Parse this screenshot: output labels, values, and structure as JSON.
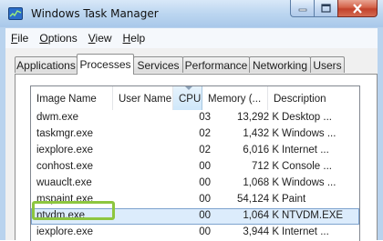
{
  "window": {
    "title": "Windows Task Manager"
  },
  "menu": {
    "file": {
      "mnemonic": "F",
      "rest": "ile"
    },
    "options": {
      "mnemonic": "O",
      "rest": "ptions"
    },
    "view": {
      "mnemonic": "V",
      "rest": "iew"
    },
    "help": {
      "mnemonic": "H",
      "rest": "elp"
    }
  },
  "tabs": {
    "applications": "Applications",
    "processes": "Processes",
    "services": "Services",
    "performance": "Performance",
    "networking": "Networking",
    "users": "Users",
    "active": "Processes"
  },
  "table": {
    "headers": {
      "image_name": "Image Name",
      "user_name": "User Name",
      "cpu": "CPU",
      "memory": "Memory (...",
      "description": "Description"
    },
    "sorted_column": "CPU",
    "rows": [
      {
        "name": "dwm.exe",
        "user": "",
        "cpu": "03",
        "mem": "13,292 K",
        "desc": "Desktop ..."
      },
      {
        "name": "taskmgr.exe",
        "user": "",
        "cpu": "02",
        "mem": "1,432 K",
        "desc": "Windows ..."
      },
      {
        "name": "iexplore.exe",
        "user": "",
        "cpu": "02",
        "mem": "6,016 K",
        "desc": "Internet ..."
      },
      {
        "name": "conhost.exe",
        "user": "",
        "cpu": "00",
        "mem": "712 K",
        "desc": "Console ..."
      },
      {
        "name": "wuauclt.exe",
        "user": "",
        "cpu": "00",
        "mem": "1,068 K",
        "desc": "Windows ..."
      },
      {
        "name": "mspaint.exe",
        "user": "",
        "cpu": "00",
        "mem": "54,124 K",
        "desc": "Paint"
      },
      {
        "name": "ntvdm.exe",
        "user": "",
        "cpu": "00",
        "mem": "1,064 K",
        "desc": "NTVDM.EXE"
      },
      {
        "name": "iexplore.exe",
        "user": "",
        "cpu": "00",
        "mem": "3,944 K",
        "desc": "Internet ..."
      }
    ],
    "selected_row": "ntvdm.exe",
    "highlighted_row": "ntvdm.exe"
  },
  "colors": {
    "highlight_box": "#8dc63f",
    "selection": "#dcecfc",
    "titlebar": "#bcd6f0"
  }
}
